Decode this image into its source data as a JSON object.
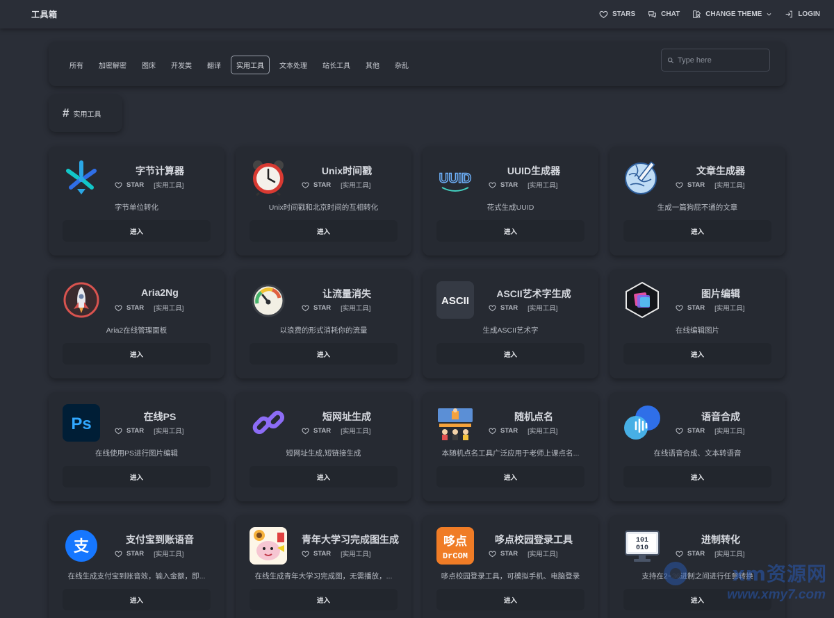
{
  "header": {
    "brand": "工具箱",
    "nav": [
      {
        "label": "STARS",
        "icon": "heart-icon"
      },
      {
        "label": "CHAT",
        "icon": "chat-icon"
      },
      {
        "label": "CHANGE THEME",
        "icon": "palette-icon"
      },
      {
        "label": "LOGIN",
        "icon": "login-icon"
      }
    ]
  },
  "filters": {
    "tabs": [
      "所有",
      "加密解密",
      "图床",
      "开发类",
      "翻译",
      "实用工具",
      "文本处理",
      "站长工具",
      "其他",
      "杂乱"
    ],
    "active_tab": "实用工具",
    "search_placeholder": "Type here"
  },
  "section": {
    "hash": "#",
    "title": "实用工具"
  },
  "cards": [
    {
      "title": "字节计算器",
      "star_label": "STAR",
      "category": "[实用工具]",
      "desc": "字节单位转化",
      "button": "进入",
      "icon": "byte-calculator-icon"
    },
    {
      "title": "Unix时间戳",
      "star_label": "STAR",
      "category": "[实用工具]",
      "desc": "Unix时间戳和北京时间的互相转化",
      "button": "进入",
      "icon": "alarm-clock-icon"
    },
    {
      "title": "UUID生成器",
      "star_label": "STAR",
      "category": "[实用工具]",
      "desc": "花式生成UUID",
      "button": "进入",
      "icon": "uuid-icon",
      "icon_text": "UUID"
    },
    {
      "title": "文章生成器",
      "star_label": "STAR",
      "category": "[实用工具]",
      "desc": "生成一篇狗屁不通的文章",
      "button": "进入",
      "icon": "globe-pencil-icon"
    },
    {
      "title": "Aria2Ng",
      "star_label": "STAR",
      "category": "[实用工具]",
      "desc": "Aria2在线管理面板",
      "button": "进入",
      "icon": "rocket-icon"
    },
    {
      "title": "让流量消失",
      "star_label": "STAR",
      "category": "[实用工具]",
      "desc": "以浪费的形式消耗你的流量",
      "button": "进入",
      "icon": "gauge-icon"
    },
    {
      "title": "ASCII艺术字生成",
      "star_label": "STAR",
      "category": "[实用工具]",
      "desc": "生成ASCII艺术字",
      "button": "进入",
      "icon": "ascii-icon",
      "icon_text": "ASCII"
    },
    {
      "title": "图片编辑",
      "star_label": "STAR",
      "category": "[实用工具]",
      "desc": "在线编辑图片",
      "button": "进入",
      "icon": "image-editor-icon"
    },
    {
      "title": "在线PS",
      "star_label": "STAR",
      "category": "[实用工具]",
      "desc": "在线使用PS进行图片编辑",
      "button": "进入",
      "icon": "photoshop-icon",
      "icon_text": "Ps"
    },
    {
      "title": "短网址生成",
      "star_label": "STAR",
      "category": "[实用工具]",
      "desc": "短网址生成,短链接生成",
      "button": "进入",
      "icon": "link-icon"
    },
    {
      "title": "随机点名",
      "star_label": "STAR",
      "category": "[实用工具]",
      "desc": "本随机点名工具广泛应用于老师上课点名...",
      "button": "进入",
      "icon": "classroom-icon"
    },
    {
      "title": "语音合成",
      "star_label": "STAR",
      "category": "[实用工具]",
      "desc": "在线语音合成、文本转语音",
      "button": "进入",
      "icon": "voice-icon"
    },
    {
      "title": "支付宝到账语音",
      "star_label": "STAR",
      "category": "[实用工具]",
      "desc": "在线生成支付宝到账音效，输入金额，即...",
      "button": "进入",
      "icon": "alipay-icon",
      "icon_text": "支"
    },
    {
      "title": "青年大学习完成图生成",
      "star_label": "STAR",
      "category": "[实用工具]",
      "desc": "在线生成青年大学习完成图，无需播放，...",
      "button": "进入",
      "icon": "cartoon-icon"
    },
    {
      "title": "哆点校园登录工具",
      "star_label": "STAR",
      "category": "[实用工具]",
      "desc": "哆点校园登录工具，可模拟手机、电脑登录",
      "button": "进入",
      "icon": "drcom-icon",
      "icon_text": "哆点",
      "icon_subtext": "DrCOM"
    },
    {
      "title": "进制转化",
      "star_label": "STAR",
      "category": "[实用工具]",
      "desc": "支持在2~36进制之间进行任意转换",
      "button": "进入",
      "icon": "binary-monitor-icon",
      "icon_text": "101",
      "icon_subtext": "010"
    }
  ],
  "watermark": {
    "name": "xm资源网",
    "url": "www.xmy7.com"
  }
}
